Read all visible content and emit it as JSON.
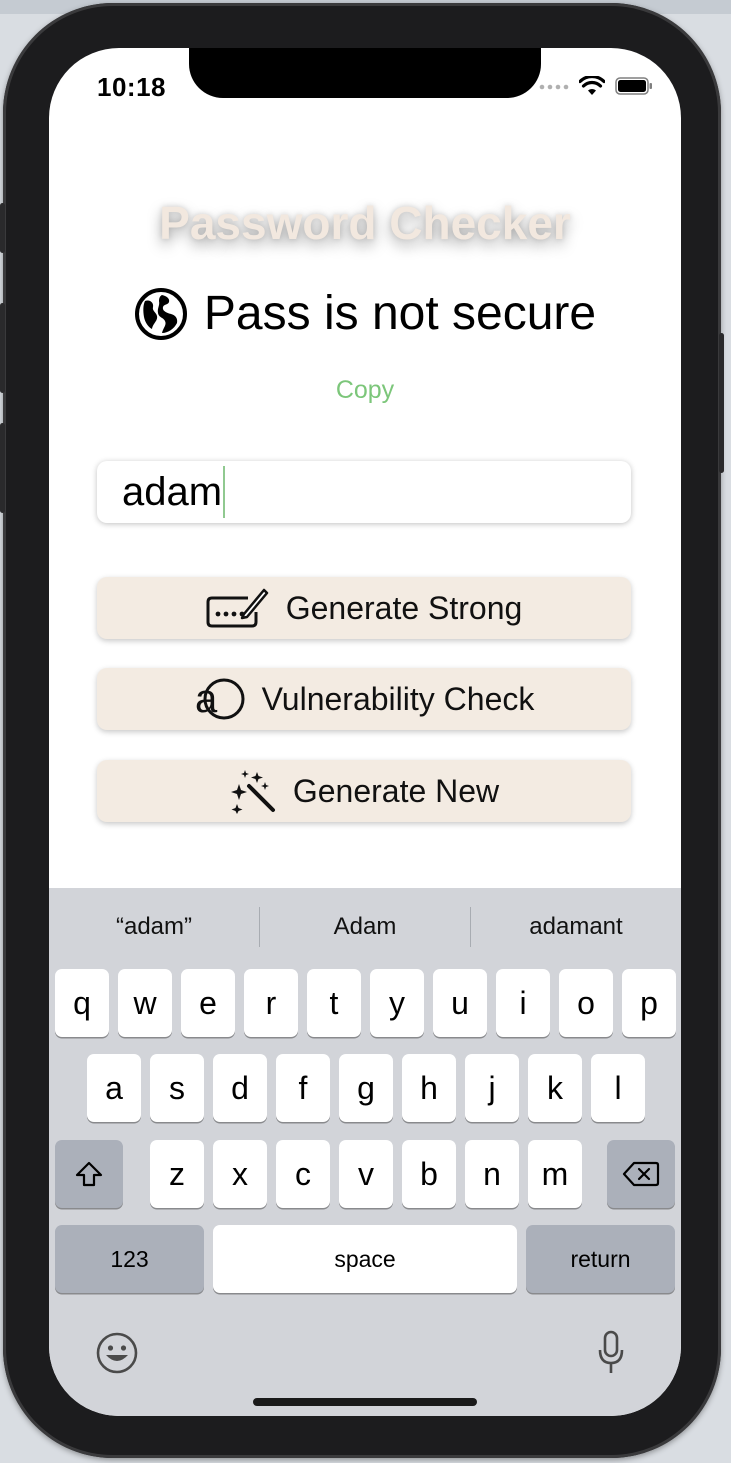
{
  "status_bar": {
    "time": "10:18"
  },
  "app": {
    "title": "Password Checker",
    "status_message": "Pass is not secure",
    "copy_label": "Copy",
    "password_value": "adam"
  },
  "actions": [
    {
      "label": "Generate Strong",
      "icon": "password-icon"
    },
    {
      "label": "Vulnerability Check",
      "icon": "character-icon"
    },
    {
      "label": "Generate New",
      "icon": "magic-wand-icon"
    }
  ],
  "keyboard": {
    "suggestions": [
      "“adam”",
      "Adam",
      "adamant"
    ],
    "row1": [
      "q",
      "w",
      "e",
      "r",
      "t",
      "y",
      "u",
      "i",
      "o",
      "p"
    ],
    "row2": [
      "a",
      "s",
      "d",
      "f",
      "g",
      "h",
      "j",
      "k",
      "l"
    ],
    "row3": [
      "z",
      "x",
      "c",
      "v",
      "b",
      "n",
      "m"
    ],
    "numbers_label": "123",
    "space_label": "space",
    "return_label": "return"
  },
  "colors": {
    "title": "#f2e8df",
    "copy": "#7cc67a",
    "button_bg": "#f3ebe2",
    "keyboard_bg": "#d2d4d9"
  }
}
